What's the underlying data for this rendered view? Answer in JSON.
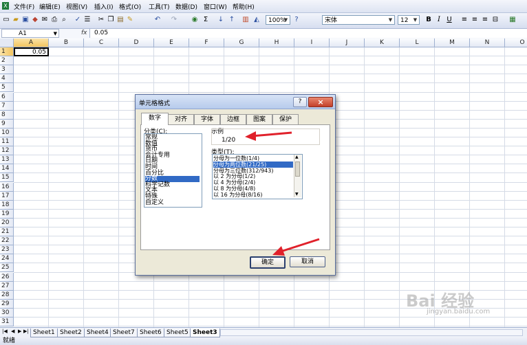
{
  "menubar": {
    "items": [
      "文件(F)",
      "编辑(E)",
      "视图(V)",
      "插入(I)",
      "格式(O)",
      "工具(T)",
      "数据(D)",
      "窗口(W)",
      "帮助(H)"
    ]
  },
  "toolbar": {
    "zoom": "100%",
    "font_name": "宋体",
    "font_size": "12",
    "bold": "B",
    "italic": "I",
    "underline": "U",
    "sigma": "Σ",
    "fx_icon": "fx"
  },
  "formula_bar": {
    "name_box": "A1",
    "fx_label": "fx",
    "formula_value": "0.05"
  },
  "grid": {
    "columns": [
      "A",
      "B",
      "C",
      "D",
      "E",
      "F",
      "G",
      "H",
      "I",
      "J",
      "K",
      "L",
      "M",
      "N",
      "O"
    ],
    "rows": [
      "1",
      "2",
      "3",
      "4",
      "5",
      "6",
      "7",
      "8",
      "9",
      "10",
      "11",
      "12",
      "13",
      "14",
      "15",
      "16",
      "17",
      "18",
      "19",
      "20",
      "21",
      "22",
      "23",
      "24",
      "25",
      "26",
      "27",
      "28",
      "29",
      "30",
      "31"
    ],
    "a1_value": "0.05"
  },
  "sheet_tabs": [
    "Sheet1",
    "Sheet2",
    "Sheet4",
    "Sheet7",
    "Sheet6",
    "Sheet5",
    "Sheet3"
  ],
  "status": {
    "text": "就绪"
  },
  "dialog": {
    "title": "单元格格式",
    "help": "?",
    "close": "×",
    "tabs": [
      "数字",
      "对齐",
      "字体",
      "边框",
      "图案",
      "保护"
    ],
    "category_label": "分类(C):",
    "categories": [
      "常规",
      "数值",
      "货币",
      "会计专用",
      "日期",
      "时间",
      "百分比",
      "分数",
      "科学记数",
      "文本",
      "特殊",
      "自定义"
    ],
    "selected_category": "分数",
    "sample_label": "示例",
    "sample_value": "1/20",
    "type_label": "类型(T):",
    "types": [
      "分母为一位数(1/4)",
      "分母为两位数(21/25)",
      "分母为三位数(312/943)",
      "以 2 为分母(1/2)",
      "以 4 为分母(2/4)",
      "以 8 为分母(4/8)",
      "以 16 为分母(8/16)"
    ],
    "selected_type": "分母为两位数(21/25)",
    "ok": "确定",
    "cancel": "取消"
  },
  "watermark": {
    "brand": "Bai 经验",
    "url": "jingyan.baidu.com"
  }
}
